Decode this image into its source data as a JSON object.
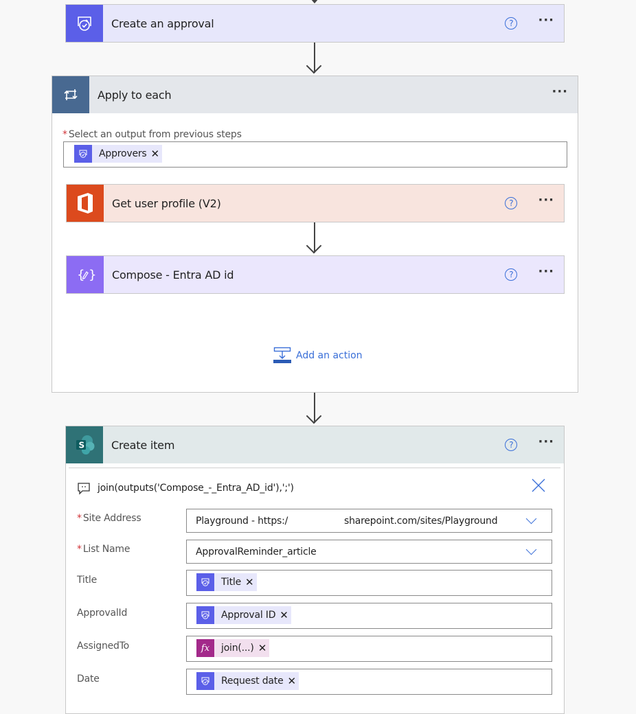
{
  "colors": {
    "approval": "#5b5fe8",
    "approval_bg": "#e7e7fb",
    "loop": "#486991",
    "loop_bg": "#e4e7eb",
    "office": "#dc4a1d",
    "office_bg": "#f8e4de",
    "compose": "#8c6cf3",
    "compose_bg": "#ebe7fd",
    "sharepoint": "#036c70",
    "sharepoint_bg": "#e1e9ea",
    "expression": "#a3298a",
    "expression_bg": "#f2dfee",
    "link": "#3a6fd8",
    "required": "#d13438"
  },
  "steps": {
    "create_approval": {
      "title": "Create an approval",
      "icon": "approval-icon",
      "help": "?",
      "more": "···"
    },
    "apply_to_each": {
      "title": "Apply to each",
      "icon": "loop-icon",
      "more": "···",
      "output_label": "Select an output from previous steps",
      "required_mark": "*",
      "output_token": "Approvers",
      "token_remove": "✕",
      "children": {
        "get_user_profile": {
          "title": "Get user profile (V2)",
          "icon": "office-icon",
          "help": "?",
          "more": "···"
        },
        "compose": {
          "title": "Compose - Entra AD id",
          "icon": "compose-icon",
          "help": "?",
          "more": "···"
        }
      },
      "add_action": "Add an action"
    },
    "create_item": {
      "title": "Create item",
      "icon": "sharepoint-icon",
      "help": "?",
      "more": "···",
      "comment": "join(outputs('Compose_-_Entra_AD_id'),';')",
      "close": "✕",
      "fields": {
        "site_address": {
          "label": "Site Address",
          "required": true,
          "value_left": "Playground - https:/",
          "value_right": "sharepoint.com/sites/Playground"
        },
        "list_name": {
          "label": "List Name",
          "required": true,
          "value": "ApprovalReminder_article"
        },
        "title": {
          "label": "Title",
          "token": "Title",
          "token_type": "approval"
        },
        "approval_id": {
          "label": "ApprovalId",
          "token": "Approval ID",
          "token_type": "approval"
        },
        "assigned_to": {
          "label": "AssignedTo",
          "token": "join(...)",
          "token_type": "expression"
        },
        "date": {
          "label": "Date",
          "token": "Request date",
          "token_type": "approval"
        }
      }
    }
  }
}
